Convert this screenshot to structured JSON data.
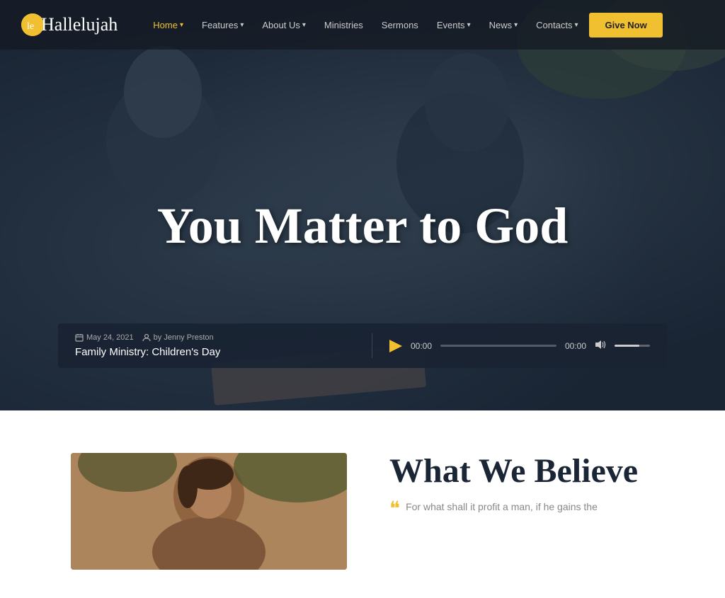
{
  "site": {
    "logo_text": "Hallelujah",
    "logo_short": "le"
  },
  "nav": {
    "items": [
      {
        "label": "Home",
        "active": true,
        "has_dropdown": true
      },
      {
        "label": "Features",
        "active": false,
        "has_dropdown": true
      },
      {
        "label": "About Us",
        "active": false,
        "has_dropdown": true
      },
      {
        "label": "Ministries",
        "active": false,
        "has_dropdown": false
      },
      {
        "label": "Sermons",
        "active": false,
        "has_dropdown": false
      },
      {
        "label": "Events",
        "active": false,
        "has_dropdown": true
      },
      {
        "label": "News",
        "active": false,
        "has_dropdown": true
      },
      {
        "label": "Contacts",
        "active": false,
        "has_dropdown": true
      }
    ],
    "cta_label": "Give Now"
  },
  "hero": {
    "title": "You Matter to God"
  },
  "audio_player": {
    "date": "May 24, 2021",
    "author": "by Jenny Preston",
    "title": "Family Ministry: Children's Day",
    "time_current": "00:00",
    "time_total": "00:00",
    "progress_percent": 0,
    "volume_percent": 70
  },
  "believe_section": {
    "heading": "What We Believe",
    "quote_mark": "““",
    "quote_text": "For what shall it profit a man, if he gains the"
  }
}
